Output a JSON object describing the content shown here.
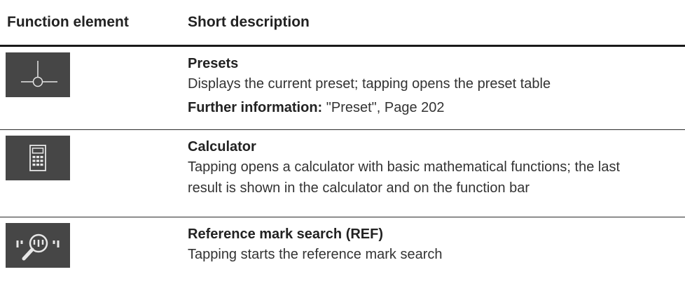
{
  "header": {
    "col1": "Function element",
    "col2": "Short description"
  },
  "rows": [
    {
      "icon": "preset-crosshair-icon",
      "title": "Presets",
      "desc": "Displays the current preset; tapping opens the preset table",
      "info_label": "Further information:",
      "info_text": " \"Preset\", Page 202"
    },
    {
      "icon": "calculator-icon",
      "title": "Calculator",
      "desc": "Tapping opens a calculator with basic mathematical functions; the last result is shown in the calculator and on the function bar"
    },
    {
      "icon": "reference-mark-search-icon",
      "title": "Reference mark search (REF)",
      "desc": "Tapping starts the reference mark search"
    }
  ],
  "colors": {
    "icon_bg": "#464646",
    "rule": "#1a1a1a"
  }
}
